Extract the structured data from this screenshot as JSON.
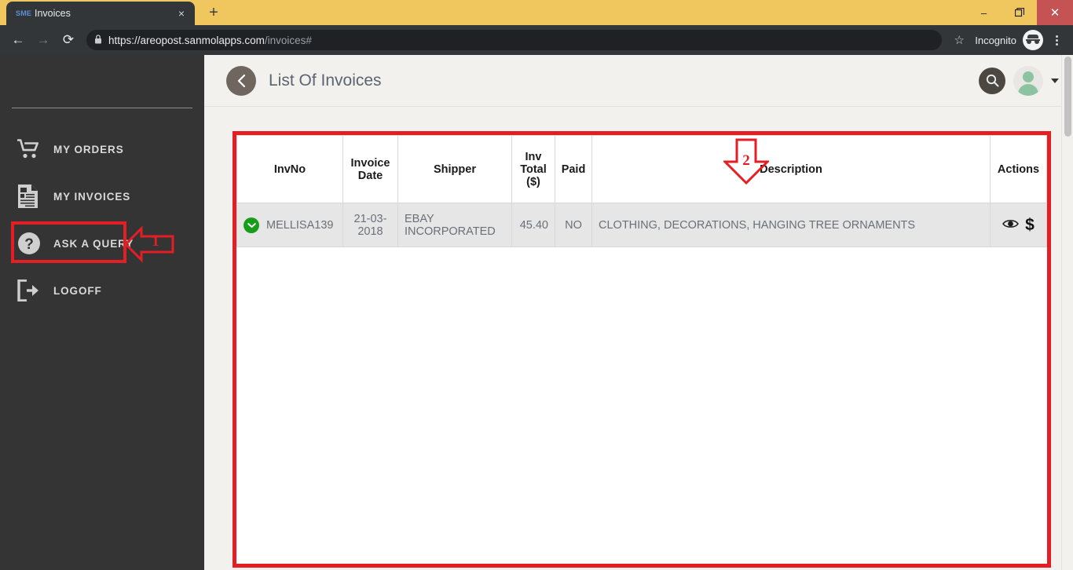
{
  "browser": {
    "tab": {
      "favicon_text": "SME",
      "title": "Invoices",
      "close_icon": "×"
    },
    "new_tab_label": "+",
    "window_controls": {
      "minimize": "–",
      "maximize": "❐",
      "close": "✕"
    },
    "nav": {
      "back": "←",
      "forward": "→",
      "reload": "⟳"
    },
    "omnibox": {
      "lock_icon": "🔒",
      "url_secure": "https://areopost.sanmolapps.com",
      "url_path": "/invoices#",
      "full_url": "https://areopost.sanmolapps.com/invoices#"
    },
    "star_icon": "☆",
    "incognito_label": "Incognito",
    "menu_icon": "kebab-menu-icon",
    "colors": {
      "titlebar": "#efc75e",
      "toolbar": "#323639",
      "close_button": "#c65353"
    }
  },
  "sidebar": {
    "items": [
      {
        "label": "MY ORDERS",
        "icon": "shopping-cart-icon"
      },
      {
        "label": "MY INVOICES",
        "icon": "invoice-document-icon"
      },
      {
        "label": "ASK A QUERY",
        "icon": "question-circle-icon"
      },
      {
        "label": "LOGOFF",
        "icon": "logoff-arrow-icon"
      }
    ]
  },
  "header": {
    "back_icon": "‹",
    "title": "List Of Invoices",
    "search_icon": "search-icon",
    "avatar_icon": "user-avatar-icon",
    "dropdown_icon": "chevron-down-icon"
  },
  "table": {
    "columns": [
      "InvNo",
      "Invoice Date",
      "Shipper",
      "Inv Total ($)",
      "Paid",
      "Description",
      "Actions"
    ],
    "column_header_lines": {
      "invoice_date": [
        "Invoice",
        "Date"
      ],
      "inv_total": [
        "Inv",
        "Total",
        "($)"
      ]
    },
    "rows": [
      {
        "status_icon": "⌄",
        "invno": "MELLISA139",
        "invoice_date": "21-03-2018",
        "invoice_date_line1": "21-03-",
        "invoice_date_line2": "2018",
        "shipper": "EBAY INCORPORATED",
        "shipper_line1": "EBAY",
        "shipper_line2": "INCORPORATED",
        "inv_total": "45.40",
        "paid": "NO",
        "description": "CLOTHING, DECORATIONS, HANGING TREE ORNAMENTS",
        "actions": {
          "view_icon": "eye-icon",
          "pay_icon": "$"
        }
      }
    ]
  },
  "annotations": [
    {
      "id": "1",
      "label": "1",
      "target": "MY INVOICES",
      "direction": "left"
    },
    {
      "id": "2",
      "label": "2",
      "target": "invoices-table",
      "direction": "down"
    }
  ],
  "colors": {
    "annotation_red": "#e31e24",
    "sidebar_bg": "#343434",
    "content_bg": "#f2f1ed",
    "status_green": "#169d1a",
    "avatar_green": "#8cc3a0"
  }
}
